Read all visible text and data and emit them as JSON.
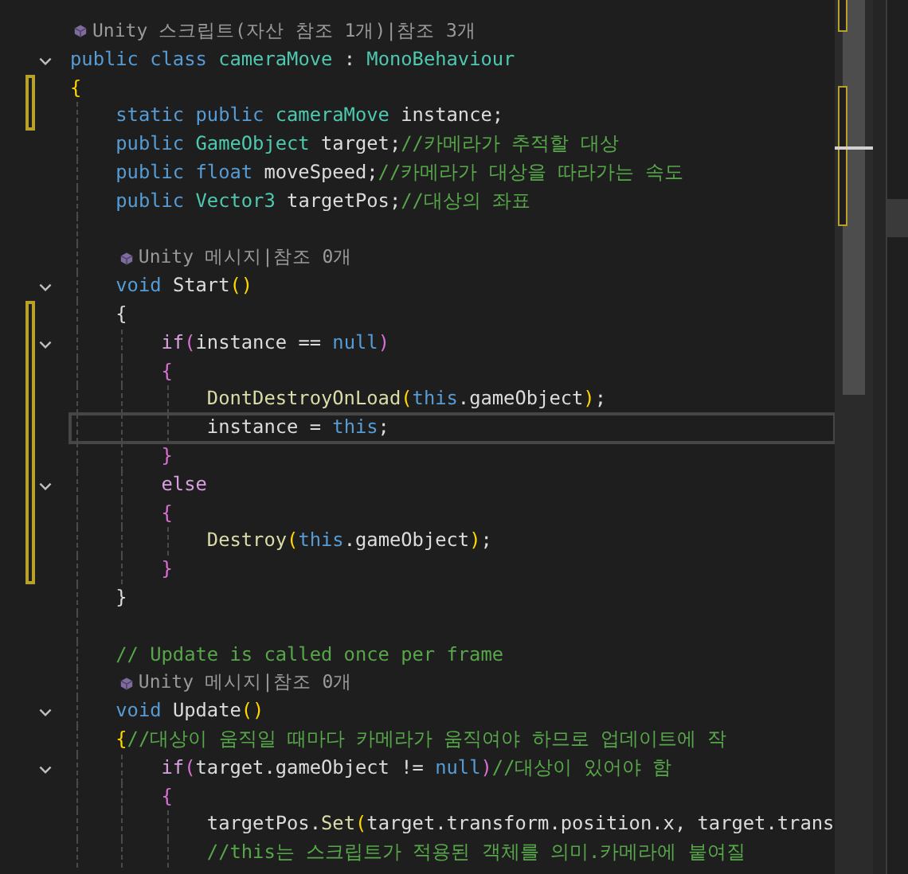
{
  "editor": {
    "lines": [
      {
        "kind": "lens",
        "text": "Unity 스크립트(자산 참조 1개)|참조 3개",
        "changed": false,
        "selected": false
      },
      {
        "kind": "code",
        "tokens": [
          {
            "kind": "kw",
            "s": "public class "
          },
          {
            "kind": "type",
            "s": "cameraMove"
          },
          {
            "kind": "text",
            "s": " : "
          },
          {
            "kind": "type",
            "s": "MonoBehaviour"
          }
        ],
        "fold": {
          "expanded": true
        },
        "changed": false,
        "selected": false
      },
      {
        "kind": "code",
        "tokens": [
          {
            "kind": "gold",
            "s": "{"
          }
        ],
        "changed": true,
        "selected": false
      },
      {
        "kind": "code",
        "tokens": [
          {
            "kind": "kw",
            "s": "    static public "
          },
          {
            "kind": "type",
            "s": "cameraMove"
          },
          {
            "kind": "text",
            "s": " instance;"
          }
        ],
        "changed": true,
        "selected": false
      },
      {
        "kind": "code",
        "tokens": [
          {
            "kind": "kw",
            "s": "    public "
          },
          {
            "kind": "type",
            "s": "GameObject"
          },
          {
            "kind": "text",
            "s": " target;"
          },
          {
            "kind": "comment",
            "s": "//카메라가 추적할 대상"
          }
        ],
        "changed": false,
        "selected": false
      },
      {
        "kind": "code",
        "tokens": [
          {
            "kind": "kw",
            "s": "    public float"
          },
          {
            "kind": "text",
            "s": " moveSpeed;"
          },
          {
            "kind": "comment",
            "s": "//카메라가 대상을 따라가는 속도"
          }
        ],
        "changed": false,
        "selected": false
      },
      {
        "kind": "code",
        "tokens": [
          {
            "kind": "kw",
            "s": "    public "
          },
          {
            "kind": "type",
            "s": "Vector3"
          },
          {
            "kind": "text",
            "s": " targetPos;"
          },
          {
            "kind": "comment",
            "s": "//대상의 좌표"
          }
        ],
        "changed": false,
        "selected": false
      },
      {
        "kind": "blank",
        "changed": false,
        "selected": false
      },
      {
        "kind": "lens",
        "text": "Unity 메시지|참조 0개",
        "changed": false,
        "selected": false
      },
      {
        "kind": "code",
        "tokens": [
          {
            "kind": "kw",
            "s": "    void "
          },
          {
            "kind": "text",
            "s": "Start"
          },
          {
            "kind": "gold",
            "s": "()"
          }
        ],
        "fold": {
          "expanded": true
        },
        "changed": false,
        "selected": false
      },
      {
        "kind": "code",
        "tokens": [
          {
            "kind": "text",
            "s": "    {"
          }
        ],
        "changed": true,
        "selected": false
      },
      {
        "kind": "code",
        "tokens": [
          {
            "kind": "ctrl",
            "s": "        if"
          },
          {
            "kind": "pink",
            "s": "("
          },
          {
            "kind": "text",
            "s": "instance == "
          },
          {
            "kind": "kw",
            "s": "null"
          },
          {
            "kind": "pink",
            "s": ")"
          }
        ],
        "fold": {
          "expanded": true
        },
        "changed": true,
        "selected": false
      },
      {
        "kind": "code",
        "tokens": [
          {
            "kind": "pink",
            "s": "        {"
          }
        ],
        "changed": true,
        "selected": false
      },
      {
        "kind": "code",
        "tokens": [
          {
            "kind": "method",
            "s": "            DontDestroyOnLoad"
          },
          {
            "kind": "gold",
            "s": "("
          },
          {
            "kind": "kw",
            "s": "this"
          },
          {
            "kind": "text",
            "s": ".gameObject"
          },
          {
            "kind": "gold",
            "s": ")"
          },
          {
            "kind": "text",
            "s": ";"
          }
        ],
        "changed": true,
        "selected": false
      },
      {
        "kind": "code",
        "tokens": [
          {
            "kind": "text",
            "s": "            instance = "
          },
          {
            "kind": "kw",
            "s": "this"
          },
          {
            "kind": "text",
            "s": ";"
          }
        ],
        "changed": true,
        "selected": true
      },
      {
        "kind": "code",
        "tokens": [
          {
            "kind": "pink",
            "s": "        }"
          }
        ],
        "changed": true,
        "selected": false
      },
      {
        "kind": "code",
        "tokens": [
          {
            "kind": "ctrl",
            "s": "        else"
          }
        ],
        "fold": {
          "expanded": true
        },
        "changed": true,
        "selected": false
      },
      {
        "kind": "code",
        "tokens": [
          {
            "kind": "pink",
            "s": "        {"
          }
        ],
        "changed": true,
        "selected": false
      },
      {
        "kind": "code",
        "tokens": [
          {
            "kind": "method",
            "s": "            Destroy"
          },
          {
            "kind": "gold",
            "s": "("
          },
          {
            "kind": "kw",
            "s": "this"
          },
          {
            "kind": "text",
            "s": ".gameObject"
          },
          {
            "kind": "gold",
            "s": ")"
          },
          {
            "kind": "text",
            "s": ";"
          }
        ],
        "changed": true,
        "selected": false
      },
      {
        "kind": "code",
        "tokens": [
          {
            "kind": "pink",
            "s": "        }"
          }
        ],
        "changed": true,
        "selected": false
      },
      {
        "kind": "code",
        "tokens": [
          {
            "kind": "text",
            "s": "    }"
          }
        ],
        "changed": false,
        "selected": false
      },
      {
        "kind": "blank",
        "changed": false,
        "selected": false
      },
      {
        "kind": "code",
        "tokens": [
          {
            "kind": "comment",
            "s": "    // Update is called once per frame"
          }
        ],
        "changed": false,
        "selected": false
      },
      {
        "kind": "lens",
        "text": "Unity 메시지|참조 0개",
        "changed": false,
        "selected": false
      },
      {
        "kind": "code",
        "tokens": [
          {
            "kind": "kw",
            "s": "    void "
          },
          {
            "kind": "text",
            "s": "Update"
          },
          {
            "kind": "gold",
            "s": "()"
          }
        ],
        "fold": {
          "expanded": true
        },
        "changed": false,
        "selected": false
      },
      {
        "kind": "code",
        "tokens": [
          {
            "kind": "gold",
            "s": "    {"
          },
          {
            "kind": "comment",
            "s": "//대상이 움직일 때마다 카메라가 움직여야 하므로 업데이트에 작"
          }
        ],
        "changed": false,
        "selected": false
      },
      {
        "kind": "code",
        "tokens": [
          {
            "kind": "ctrl",
            "s": "        if"
          },
          {
            "kind": "pink",
            "s": "("
          },
          {
            "kind": "text",
            "s": "target.gameObject != "
          },
          {
            "kind": "kw",
            "s": "null"
          },
          {
            "kind": "pink",
            "s": ")"
          },
          {
            "kind": "comment",
            "s": "//대상이 있어야 함"
          }
        ],
        "fold": {
          "expanded": true
        },
        "changed": false,
        "selected": false
      },
      {
        "kind": "code",
        "tokens": [
          {
            "kind": "pink",
            "s": "        {"
          }
        ],
        "changed": false,
        "selected": false
      },
      {
        "kind": "code",
        "tokens": [
          {
            "kind": "text",
            "s": "            targetPos."
          },
          {
            "kind": "method",
            "s": "Set"
          },
          {
            "kind": "gold",
            "s": "("
          },
          {
            "kind": "text",
            "s": "target.transform.position.x, target.trans"
          }
        ],
        "changed": false,
        "selected": false
      },
      {
        "kind": "code",
        "tokens": [
          {
            "kind": "comment",
            "s": "            //this는 스크립트가 적용된 객체를 의미.카메라에 붙여질"
          }
        ],
        "changed": false,
        "selected": false
      }
    ]
  }
}
